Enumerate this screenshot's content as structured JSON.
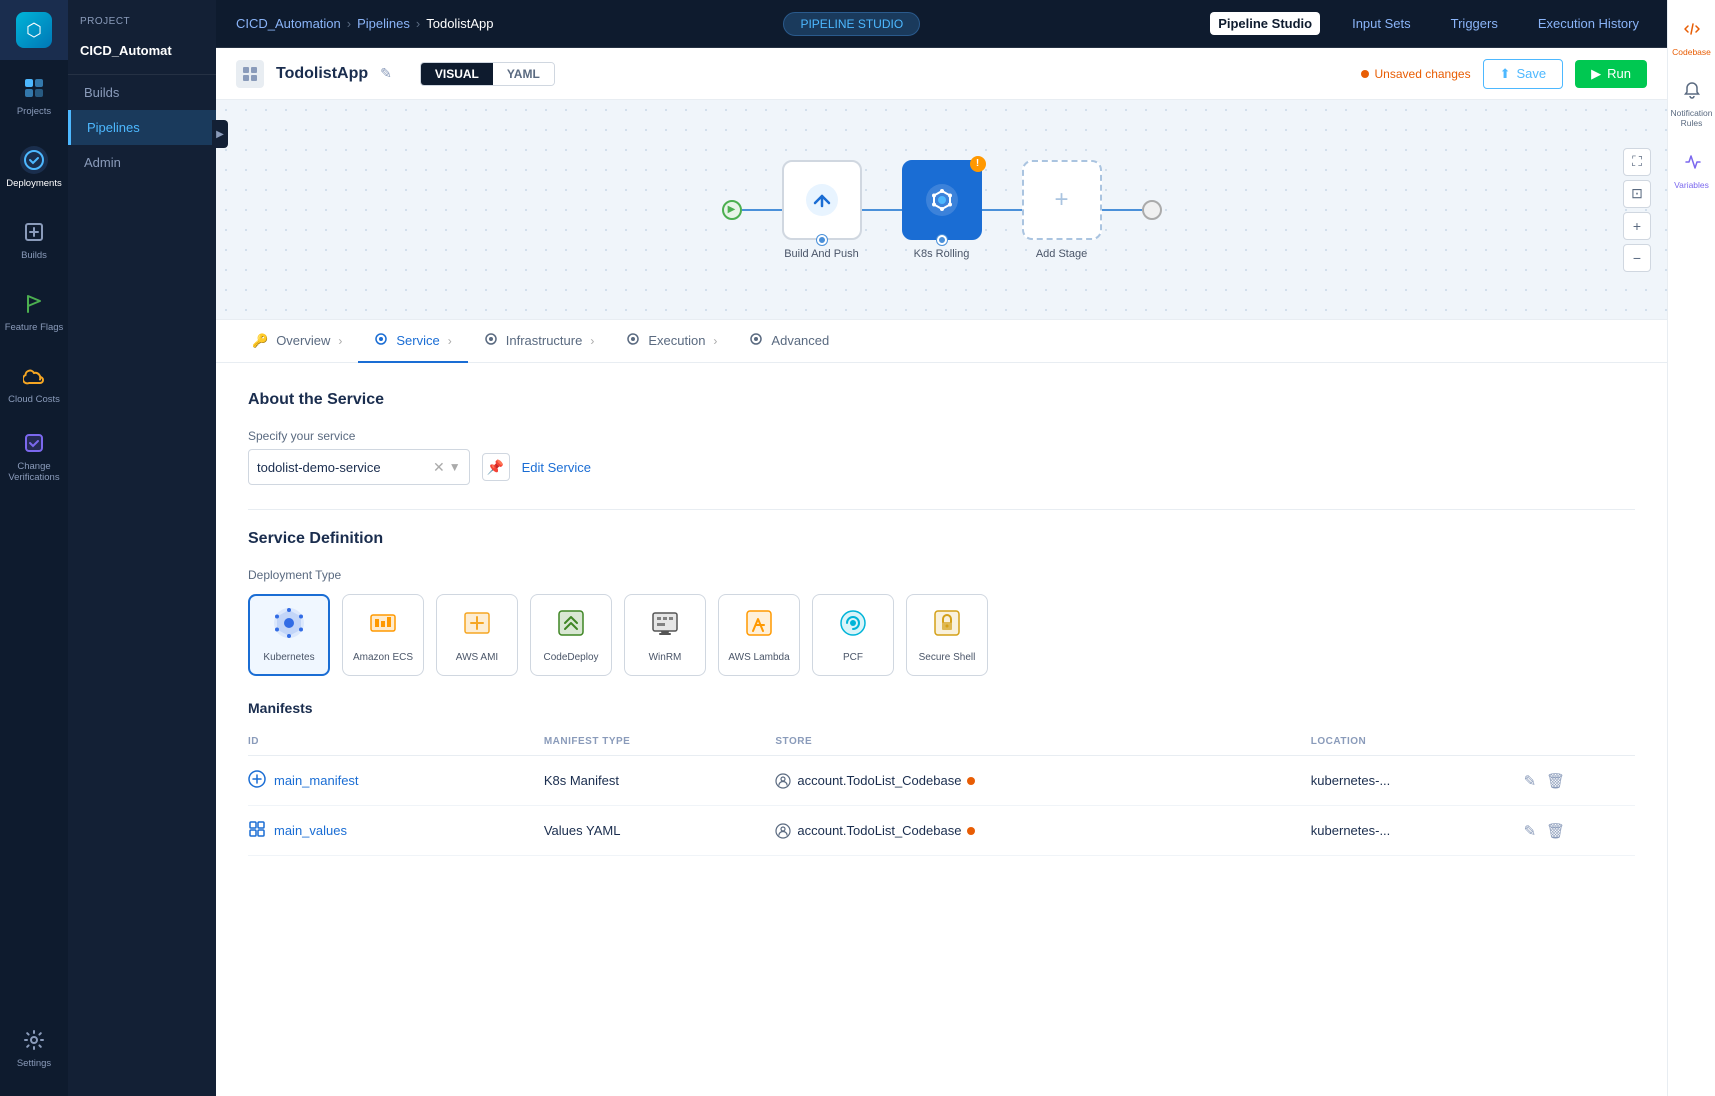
{
  "app": {
    "title": "CICD_Automation"
  },
  "leftSidebar": {
    "items": [
      {
        "id": "projects",
        "label": "Projects",
        "icon": "⬡",
        "active": false
      },
      {
        "id": "deployments",
        "label": "Deployments",
        "icon": "🔄",
        "active": false
      },
      {
        "id": "builds",
        "label": "Builds",
        "icon": "🔨",
        "active": false
      },
      {
        "id": "feature-flags",
        "label": "Feature Flags",
        "icon": "🚩",
        "active": false
      },
      {
        "id": "cloud-costs",
        "label": "Cloud Costs",
        "icon": "☁",
        "active": false
      },
      {
        "id": "change-verifications",
        "label": "Change Verifications",
        "icon": "✓",
        "active": false
      }
    ],
    "bottomItems": [
      {
        "id": "settings",
        "label": "Settings",
        "icon": "⚙"
      }
    ]
  },
  "secondSidebar": {
    "projectLabel": "Project",
    "projectName": "CICD_Automat",
    "items": [
      {
        "id": "builds",
        "label": "Builds",
        "active": false
      },
      {
        "id": "pipelines",
        "label": "Pipelines",
        "active": true
      },
      {
        "id": "admin",
        "label": "Admin",
        "active": false
      }
    ]
  },
  "breadcrumb": {
    "items": [
      {
        "id": "cicd",
        "label": "CICD_Automation"
      },
      {
        "id": "pipelines",
        "label": "Pipelines"
      },
      {
        "id": "app",
        "label": "TodolistApp"
      }
    ]
  },
  "topNav": {
    "centerBadge": "PIPELINE STUDIO",
    "items": [
      {
        "id": "pipeline-studio",
        "label": "Pipeline Studio",
        "active": true
      },
      {
        "id": "input-sets",
        "label": "Input Sets",
        "active": false
      },
      {
        "id": "triggers",
        "label": "Triggers",
        "active": false
      },
      {
        "id": "execution-history",
        "label": "Execution History",
        "active": false
      }
    ]
  },
  "pipeline": {
    "name": "TodolistApp",
    "viewMode": "VISUAL",
    "viewModeAlt": "YAML",
    "unsavedLabel": "Unsaved changes",
    "saveLabel": "Save",
    "runLabel": "Run",
    "stages": [
      {
        "id": "build-and-push",
        "label": "Build And Push",
        "type": "build"
      },
      {
        "id": "k8s-rolling",
        "label": "K8s Rolling",
        "type": "k8s",
        "hasWarning": true
      },
      {
        "id": "add-stage",
        "label": "Add Stage",
        "type": "add"
      }
    ]
  },
  "configTabs": {
    "items": [
      {
        "id": "overview",
        "label": "Overview",
        "icon": "🔑",
        "active": false
      },
      {
        "id": "service",
        "label": "Service",
        "icon": "⚙",
        "active": true
      },
      {
        "id": "infrastructure",
        "label": "Infrastructure",
        "icon": "⚙",
        "active": false
      },
      {
        "id": "execution",
        "label": "Execution",
        "icon": "⚙",
        "active": false
      },
      {
        "id": "advanced",
        "label": "Advanced",
        "icon": "⚙",
        "active": false
      }
    ]
  },
  "serviceSection": {
    "title": "About the Service",
    "specifyLabel": "Specify your service",
    "serviceValue": "todolist-demo-service",
    "editServiceLabel": "Edit Service",
    "definitionTitle": "Service Definition",
    "deploymentTypeLabel": "Deployment Type",
    "deploymentTypes": [
      {
        "id": "kubernetes",
        "label": "Kubernetes",
        "icon": "⚙",
        "selected": true
      },
      {
        "id": "amazon-ecs",
        "label": "Amazon ECS",
        "icon": "🟠"
      },
      {
        "id": "aws-ami",
        "label": "AWS AMI",
        "icon": "🟡"
      },
      {
        "id": "codedeploy",
        "label": "CodeDeploy",
        "icon": "🟢"
      },
      {
        "id": "winrm",
        "label": "WinRM",
        "icon": "⬛"
      },
      {
        "id": "aws-lambda",
        "label": "AWS Lambda",
        "icon": "🟠"
      },
      {
        "id": "pcf",
        "label": "PCF",
        "icon": "🔵"
      },
      {
        "id": "secure-shell",
        "label": "Secure Shell",
        "icon": "🟡"
      }
    ],
    "manifestsTitle": "Manifests",
    "manifestColumns": [
      {
        "id": "id",
        "label": "ID"
      },
      {
        "id": "manifest-type",
        "label": "MANIFEST TYPE"
      },
      {
        "id": "store",
        "label": "STORE"
      },
      {
        "id": "location",
        "label": "LOCATION"
      }
    ],
    "manifests": [
      {
        "id": "main_manifest",
        "type": "K8s Manifest",
        "store": "account.TodoList_Codebase",
        "location": "kubernetes-...",
        "storeHasDot": true
      },
      {
        "id": "main_values",
        "type": "Values YAML",
        "store": "account.TodoList_Codebase",
        "location": "kubernetes-...",
        "storeHasDot": true
      }
    ]
  },
  "rightPanel": {
    "items": [
      {
        "id": "codebase",
        "label": "Codebase",
        "icon": "</>"
      },
      {
        "id": "notification-rules",
        "label": "Notification Rules",
        "icon": "🔔"
      },
      {
        "id": "variables",
        "label": "Variables",
        "icon": "Σ"
      }
    ]
  }
}
